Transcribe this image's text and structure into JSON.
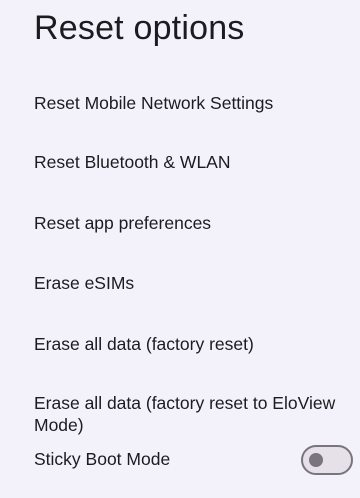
{
  "title": "Reset options",
  "options": [
    {
      "label": "Reset Mobile Network Settings"
    },
    {
      "label": "Reset Bluetooth & WLAN"
    },
    {
      "label": "Reset app preferences"
    },
    {
      "label": "Erase eSIMs"
    },
    {
      "label": "Erase all data (factory reset)"
    },
    {
      "label": "Erase all data (factory reset to EloView Mode)"
    }
  ],
  "sticky_boot": {
    "label": "Sticky Boot Mode",
    "enabled": false
  },
  "colors": {
    "background": "#F3F1FA",
    "text": "#1C1B1F",
    "toggle_off_outline": "#79747E",
    "toggle_off_track": "#E6E0E9"
  }
}
